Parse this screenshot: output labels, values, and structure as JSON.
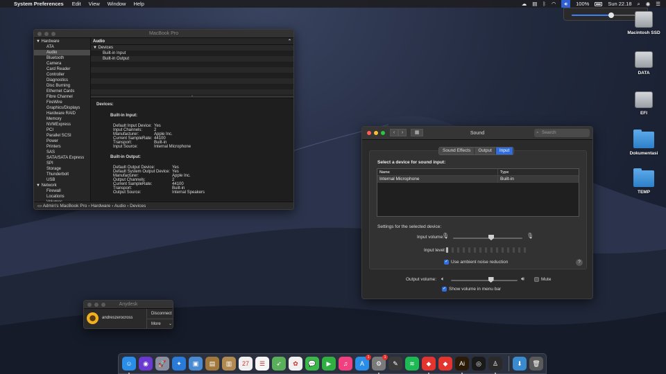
{
  "menubar": {
    "app_name": "System Preferences",
    "menus": [
      "Edit",
      "View",
      "Window",
      "Help"
    ],
    "battery": "100%",
    "clock": "Sun 22.18"
  },
  "volume_popup": {
    "level": 0.57
  },
  "desktop_icons": [
    {
      "label": "Macintosh SSD",
      "type": "drive"
    },
    {
      "label": "DATA",
      "type": "drive"
    },
    {
      "label": "EFI",
      "type": "drive"
    },
    {
      "label": "Dokumentasi",
      "type": "folder"
    },
    {
      "label": "TEMP",
      "type": "folder"
    }
  ],
  "sysinfo": {
    "title": "MacBook Pro",
    "header": "Audio",
    "sidebar": [
      {
        "label": "Hardware",
        "group": true
      },
      {
        "label": "ATA"
      },
      {
        "label": "Audio",
        "selected": true
      },
      {
        "label": "Bluetooth"
      },
      {
        "label": "Camera"
      },
      {
        "label": "Card Reader"
      },
      {
        "label": "Controller"
      },
      {
        "label": "Diagnostics"
      },
      {
        "label": "Disc Burning"
      },
      {
        "label": "Ethernet Cards"
      },
      {
        "label": "Fibre Channel"
      },
      {
        "label": "FireWire"
      },
      {
        "label": "Graphics/Displays"
      },
      {
        "label": "Hardware RAID"
      },
      {
        "label": "Memory"
      },
      {
        "label": "NVMExpress"
      },
      {
        "label": "PCI"
      },
      {
        "label": "Parallel SCSI"
      },
      {
        "label": "Power"
      },
      {
        "label": "Printers"
      },
      {
        "label": "SAS"
      },
      {
        "label": "SATA/SATA Express"
      },
      {
        "label": "SPI"
      },
      {
        "label": "Storage"
      },
      {
        "label": "Thunderbolt"
      },
      {
        "label": "USB"
      },
      {
        "label": "Network",
        "group": true
      },
      {
        "label": "Firewall"
      },
      {
        "label": "Locations"
      },
      {
        "label": "Volumes"
      }
    ],
    "tree": {
      "root": "Devices",
      "children": [
        "Built-in Input",
        "Built-in Output"
      ]
    },
    "detail": {
      "heading": "Devices:",
      "sections": [
        {
          "title": "Built-in Input:",
          "rows": [
            {
              "k": "Default Input Device:",
              "v": "Yes"
            },
            {
              "k": "Input Channels:",
              "v": "2"
            },
            {
              "k": "Manufacturer:",
              "v": "Apple Inc."
            },
            {
              "k": "Current SampleRate:",
              "v": "44100"
            },
            {
              "k": "Transport:",
              "v": "Built-in"
            },
            {
              "k": "Input Source:",
              "v": "Internal Microphone"
            }
          ]
        },
        {
          "title": "Built-in Output:",
          "rows": [
            {
              "k": "Default Output Device:",
              "v": "Yes"
            },
            {
              "k": "Default System Output Device:",
              "v": "Yes"
            },
            {
              "k": "Manufacturer:",
              "v": "Apple Inc."
            },
            {
              "k": "Output Channels:",
              "v": "2"
            },
            {
              "k": "Current SampleRate:",
              "v": "44100"
            },
            {
              "k": "Transport:",
              "v": "Built-in"
            },
            {
              "k": "Output Source:",
              "v": "Internal Speakers"
            }
          ]
        }
      ]
    },
    "path": "Admin's MacBook Pro › Hardware › Audio › Devices"
  },
  "sound": {
    "title": "Sound",
    "search_placeholder": "Search",
    "tabs": [
      "Sound Effects",
      "Output",
      "Input"
    ],
    "active_tab": "Input",
    "select_label": "Select a device for sound input:",
    "columns": [
      "Name",
      "Type"
    ],
    "devices": [
      {
        "name": "Internal Microphone",
        "type": "Built-in"
      }
    ],
    "settings_label": "Settings for the selected device:",
    "input_volume_label": "Input volume:",
    "input_volume": 0.55,
    "input_level_label": "Input level:",
    "input_level_on": 1,
    "input_level_total": 15,
    "noise_reduction_label": "Use ambient noise reduction",
    "noise_reduction": true,
    "output_volume_label": "Output volume:",
    "output_volume": 0.6,
    "mute_label": "Mute",
    "mute": false,
    "show_volume_label": "Show volume in menu bar",
    "show_volume": true,
    "help": "?"
  },
  "anydesk": {
    "title": "Anydesk",
    "user": "andreszerocross",
    "disconnect": "Disconnect",
    "more": "More"
  },
  "dock": {
    "apps": [
      {
        "name": "finder",
        "color": "#2a8de8",
        "glyph": "☺",
        "running": true
      },
      {
        "name": "siri",
        "color": "#6a3ad0",
        "glyph": "◉"
      },
      {
        "name": "launchpad",
        "color": "#8a8fa0",
        "glyph": "🚀"
      },
      {
        "name": "safari",
        "color": "#2a7ad8",
        "glyph": "✦"
      },
      {
        "name": "preview",
        "color": "#4a8ad0",
        "glyph": "▣"
      },
      {
        "name": "notefile",
        "color": "#a0783c",
        "glyph": "▤"
      },
      {
        "name": "contacts",
        "color": "#b08a50",
        "glyph": "▥"
      },
      {
        "name": "calendar",
        "color": "#f0f0f0",
        "glyph": "27"
      },
      {
        "name": "reminders",
        "color": "#f5f5f5",
        "glyph": "☰"
      },
      {
        "name": "maps",
        "color": "#5ab05a",
        "glyph": "➶"
      },
      {
        "name": "photos",
        "color": "#f0f0f0",
        "glyph": "✿"
      },
      {
        "name": "messages",
        "color": "#3ab84a",
        "glyph": "💬"
      },
      {
        "name": "facetime",
        "color": "#30b040",
        "glyph": "▶"
      },
      {
        "name": "itunes",
        "color": "#f04080",
        "glyph": "♫"
      },
      {
        "name": "app-store",
        "color": "#2a8de8",
        "glyph": "A",
        "badge": "1"
      },
      {
        "name": "system-preferences",
        "color": "#7a7a7a",
        "glyph": "⚙",
        "badge": "1",
        "running": true
      },
      {
        "name": "script-editor",
        "color": "#3a3a3a",
        "glyph": "✎"
      },
      {
        "name": "spotify",
        "color": "#1db954",
        "glyph": "≋"
      },
      {
        "name": "anydesk",
        "color": "#e3342f",
        "glyph": "◆",
        "running": true
      },
      {
        "name": "anydesk-2",
        "color": "#e3342f",
        "glyph": "◆"
      },
      {
        "name": "illustrator",
        "color": "#2b1a05",
        "glyph": "Ai",
        "running": true
      },
      {
        "name": "sketchbook",
        "color": "#1a1a1a",
        "glyph": "◎"
      },
      {
        "name": "alien-app",
        "color": "#2a2a2a",
        "glyph": "♙",
        "running": true
      }
    ],
    "trailing": [
      {
        "name": "downloads",
        "color": "#3a8ad0",
        "glyph": "⬇"
      },
      {
        "name": "trash",
        "color": "#5a5a5a",
        "glyph": "🗑"
      }
    ]
  }
}
